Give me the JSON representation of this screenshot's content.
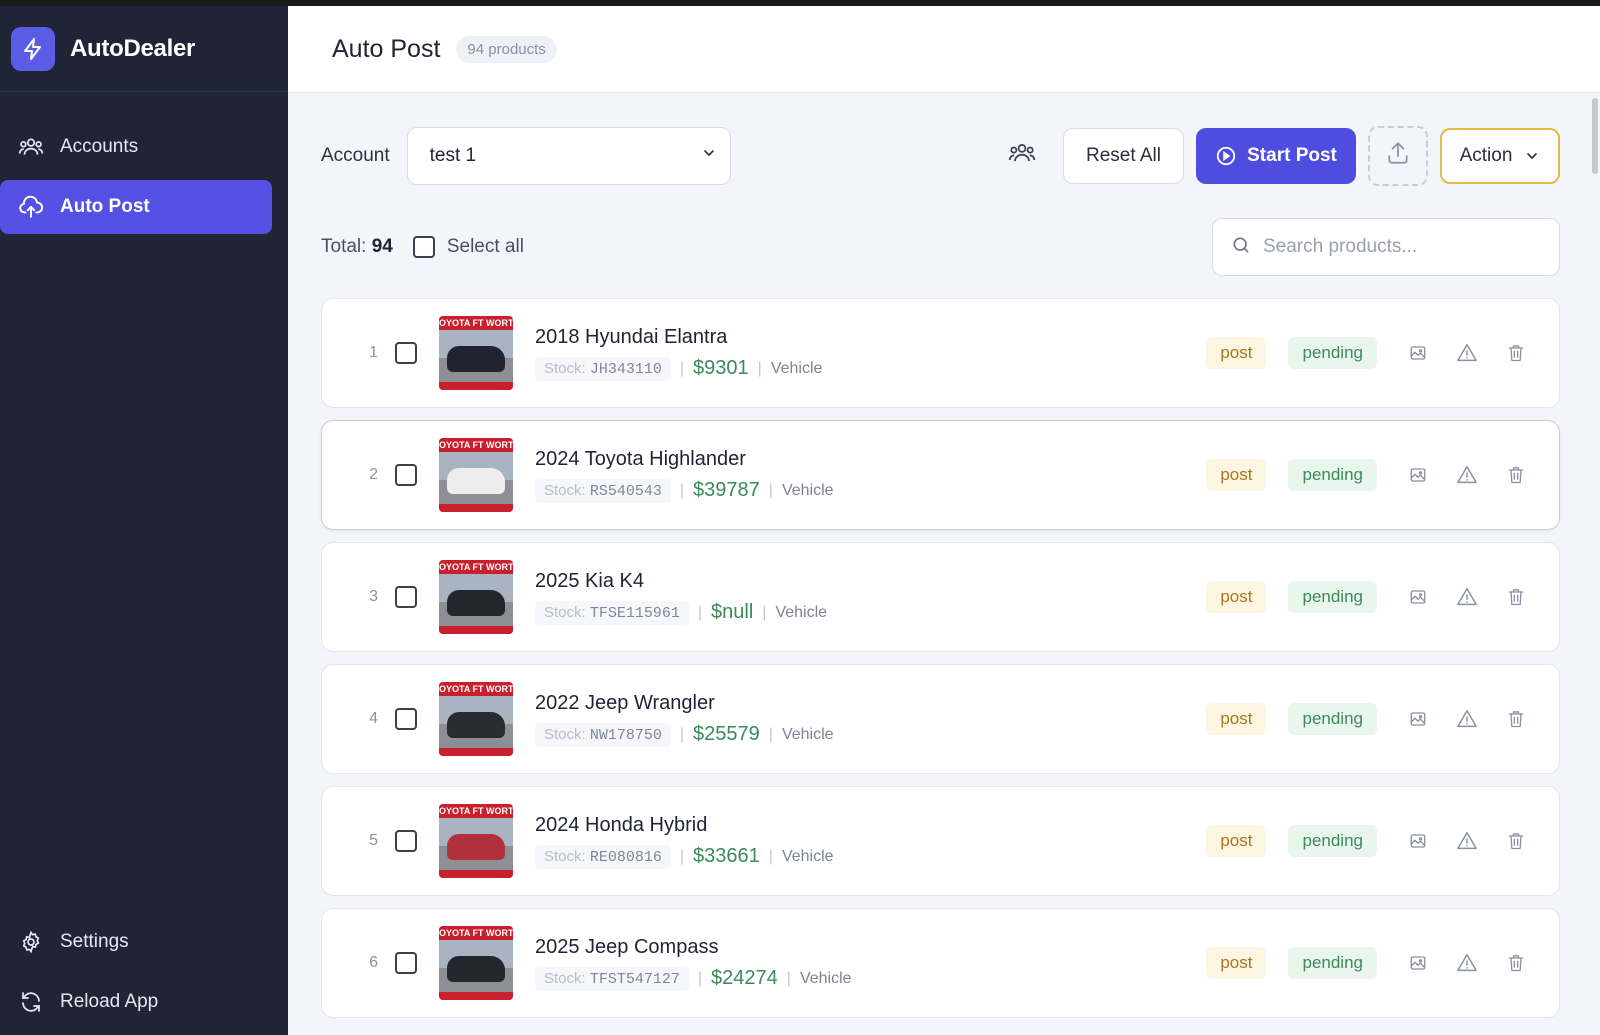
{
  "app": {
    "name": "AutoDealer"
  },
  "sidebar": {
    "items": [
      {
        "label": "Accounts",
        "icon": "users-icon"
      },
      {
        "label": "Auto Post",
        "icon": "upload-cloud-icon",
        "active": true
      }
    ],
    "bottom_items": [
      {
        "label": "Settings",
        "icon": "gear-icon"
      },
      {
        "label": "Reload App",
        "icon": "refresh-icon"
      }
    ]
  },
  "header": {
    "title": "Auto Post",
    "count_badge": "94 products"
  },
  "toolbar": {
    "account_label": "Account",
    "account_value": "test 1",
    "reset_label": "Reset All",
    "start_label": "Start Post",
    "action_label": "Action"
  },
  "filters": {
    "total_label": "Total:",
    "total_value": "94",
    "select_all_label": "Select all",
    "search_placeholder": "Search products..."
  },
  "products": [
    {
      "index": "1",
      "name": "2018 Hyundai Elantra",
      "stock_label": "Stock:",
      "stock": "JH343110",
      "price": "$9301",
      "type": "Vehicle",
      "post_tag": "post",
      "status": "pending",
      "thumb_banner": "OYOTA FT WORT",
      "car_color": "#1f2430"
    },
    {
      "index": "2",
      "name": "2024 Toyota Highlander",
      "stock_label": "Stock:",
      "stock": "RS540543",
      "price": "$39787",
      "type": "Vehicle",
      "post_tag": "post",
      "status": "pending",
      "thumb_banner": "OYOTA FT WORT",
      "car_color": "#eeeeee"
    },
    {
      "index": "3",
      "name": "2025 Kia K4",
      "stock_label": "Stock:",
      "stock": "TFSE115961",
      "price": "$null",
      "type": "Vehicle",
      "post_tag": "post",
      "status": "pending",
      "thumb_banner": "OYOTA FT WORT",
      "car_color": "#23262d"
    },
    {
      "index": "4",
      "name": "2022 Jeep Wrangler",
      "stock_label": "Stock:",
      "stock": "NW178750",
      "price": "$25579",
      "type": "Vehicle",
      "post_tag": "post",
      "status": "pending",
      "thumb_banner": "OYOTA FT WORT",
      "car_color": "#2a2b2f"
    },
    {
      "index": "5",
      "name": "2024 Honda Hybrid",
      "stock_label": "Stock:",
      "stock": "RE080816",
      "price": "$33661",
      "type": "Vehicle",
      "post_tag": "post",
      "status": "pending",
      "thumb_banner": "OYOTA FT WORT",
      "car_color": "#b2303a"
    },
    {
      "index": "6",
      "name": "2025 Jeep Compass",
      "stock_label": "Stock:",
      "stock": "TFST547127",
      "price": "$24274",
      "type": "Vehicle",
      "post_tag": "post",
      "status": "pending",
      "thumb_banner": "OYOTA FT WORT",
      "car_color": "#23262d"
    }
  ],
  "colors": {
    "accent": "#5450e3",
    "sidebar_bg": "#1f2437",
    "price_green": "#3a8a5a",
    "action_border": "#e6b84a"
  }
}
